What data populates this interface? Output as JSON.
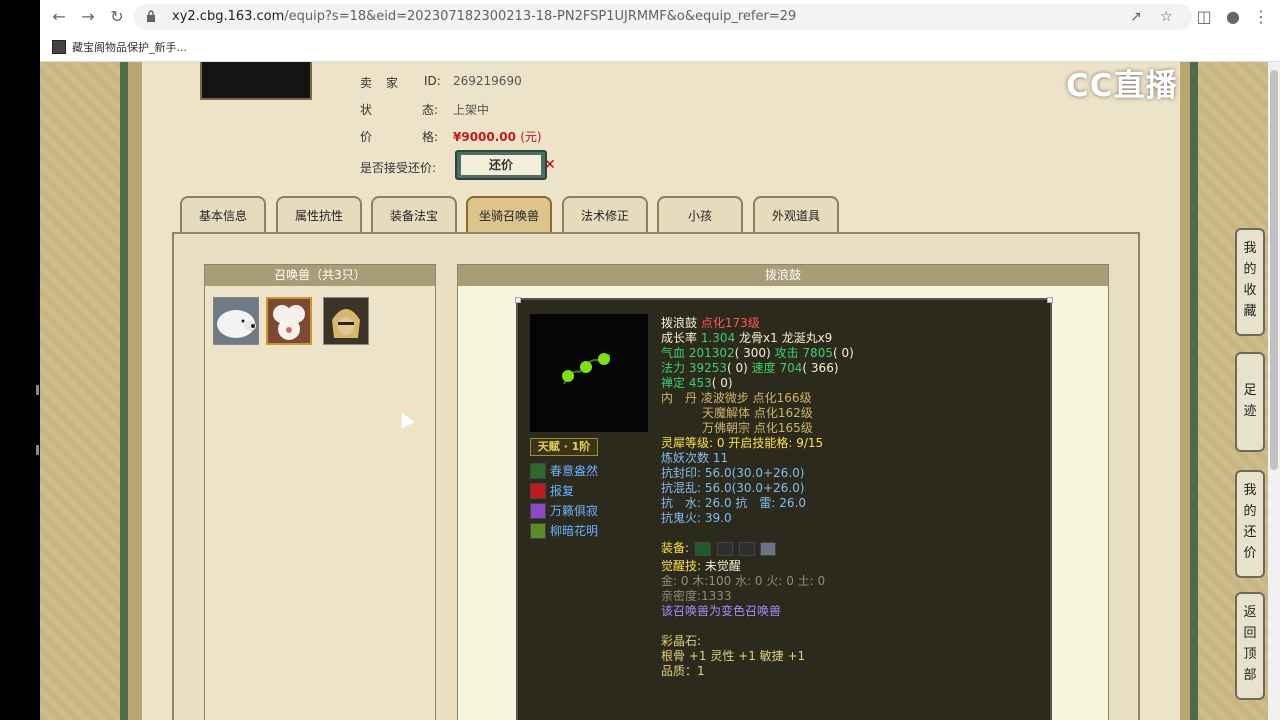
{
  "browser": {
    "url_host": "xy2.cbg.163.com",
    "url_rest": "/equip?s=18&eid=202307182300213-18-PN2FSP1UJRMMF&o&equip_refer=29",
    "bookmark": "藏宝阁物品保护_新手..."
  },
  "overlay": {
    "watermark": "CC直播"
  },
  "seller": {
    "id_label1": "卖",
    "id_label2": "家",
    "id_key": "ID:",
    "id_value": "269219690",
    "status_label1": "状",
    "status_label2": "态:",
    "status_value": "上架中",
    "price_label1": "价",
    "price_label2": "格:",
    "price_value": "¥9000.00",
    "price_unit": "(元)",
    "bargain_label": "是否接受还价:",
    "bargain_button": "还价"
  },
  "tabs": [
    {
      "label": "基本信息"
    },
    {
      "label": "属性抗性"
    },
    {
      "label": "装备法宝"
    },
    {
      "label": "坐骑召唤兽"
    },
    {
      "label": "法术修正"
    },
    {
      "label": "小孩"
    },
    {
      "label": "外观道具"
    }
  ],
  "pets_panel": {
    "title": "召唤兽（共3只）"
  },
  "detail": {
    "title": "拨浪鼓",
    "tianfu": "天赋 · 1阶",
    "skills": [
      {
        "name": "春意盎然"
      },
      {
        "name": "报复"
      },
      {
        "name": "万籁俱寂"
      },
      {
        "name": "柳暗花明"
      }
    ],
    "name": "拨浪鼓",
    "dianhua": "点化173级",
    "growth_label": "成长率",
    "growth_value": "1.304",
    "growth_items": "龙骨x1 龙涎丸x9",
    "qixue_label": "气血",
    "qixue": "201302",
    "qixue_paren": "( 300)",
    "gongji_label": "攻击",
    "gongji": "7805",
    "gongji_paren": "( 0)",
    "fali_label": "法力",
    "fali": "39253",
    "fali_paren": "( 0)",
    "sudu_label": "速度",
    "sudu": "704",
    "sudu_paren": "( 366)",
    "chanding_label": "禅定",
    "chanding": "453",
    "chanding_paren": "( 0)",
    "neidan_label": "内　丹",
    "neidan1": "凌波微步 点化166级",
    "neidan2": "天魔解体 点化162级",
    "neidan3": "万佛朝宗 点化165级",
    "lingxi_label": "灵犀等级:",
    "lingxi_value": "0 开启技能格:",
    "lingxi_slots": "9/15",
    "lianyao_label": "炼妖次数",
    "lianyao": "11",
    "kangfengyin_label": "抗封印:",
    "kangfengyin": "56.0(30.0+26.0)",
    "kanghunluan_label": "抗混乱:",
    "kanghunluan": "56.0(30.0+26.0)",
    "kangshui_label": "抗　水:",
    "kangshui": "26.0",
    "kanglei_label": "抗　雷:",
    "kanglei": "26.0",
    "kangguihuo_label": "抗鬼火:",
    "kangguihuo": "39.0",
    "equip_label": "装备:",
    "juexing_label": "觉醒技:",
    "juexing_value": "未觉醒",
    "wuxing": "金: 0 木:100 水: 0 火: 0 土: 0",
    "qinmi": "亲密度:1333",
    "bianse": "该召唤兽为变色召唤兽",
    "caijing_label": "彩晶石:",
    "caijing_value": "根骨 +1 灵性 +1 敏捷 +1",
    "pinzhi": "品质：1"
  },
  "right_nav": [
    {
      "label": [
        "我",
        "的",
        "收",
        "藏"
      ]
    },
    {
      "label": [
        "足",
        "迹"
      ]
    },
    {
      "label": [
        "我",
        "的",
        "还",
        "价"
      ]
    },
    {
      "label": [
        "返",
        "回",
        "顶",
        "部"
      ]
    }
  ],
  "colors": {
    "page_bg": "#c9b88a",
    "card_bg": "#2b2a1c",
    "price_red": "#c41a1a"
  }
}
